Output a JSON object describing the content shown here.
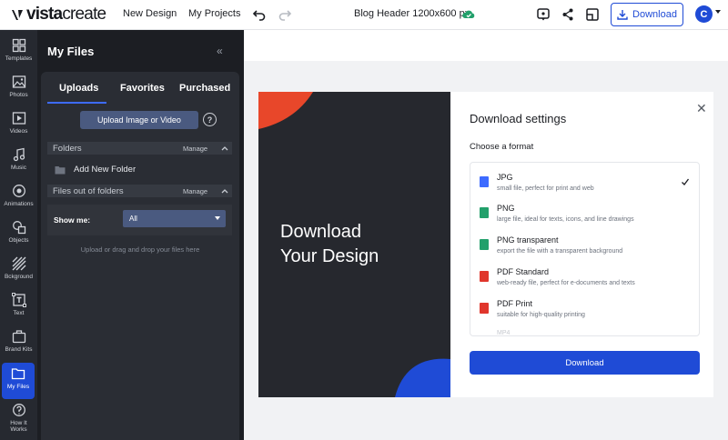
{
  "header": {
    "logo_bold": "vista",
    "logo_light": "create",
    "nav": [
      "New Design",
      "My Projects"
    ],
    "doc_title": "Blog Header 1200x600 px",
    "download_label": "Download",
    "avatar_initial": "C"
  },
  "rail": {
    "items": [
      {
        "label": "Templates",
        "icon": "templates-icon"
      },
      {
        "label": "Photos",
        "icon": "photos-icon"
      },
      {
        "label": "Videos",
        "icon": "videos-icon"
      },
      {
        "label": "Music",
        "icon": "music-icon"
      },
      {
        "label": "Animations",
        "icon": "animations-icon"
      },
      {
        "label": "Objects",
        "icon": "objects-icon"
      },
      {
        "label": "Bckground",
        "icon": "background-icon"
      },
      {
        "label": "Text",
        "icon": "text-icon"
      },
      {
        "label": "Brand Kits",
        "icon": "brand-kits-icon"
      },
      {
        "label": "My Files",
        "icon": "my-files-icon",
        "active": true
      },
      {
        "label": "How It Works",
        "icon": "how-it-works-icon"
      }
    ]
  },
  "files_panel": {
    "title": "My Files",
    "tabs": [
      "Uploads",
      "Favorites",
      "Purchased"
    ],
    "active_tab": "Uploads",
    "upload_button": "Upload Image or Video",
    "help_glyph": "?",
    "folders_section": {
      "label": "Folders",
      "manage": "Manage"
    },
    "add_folder": "Add New Folder",
    "loose_section": {
      "label": "Files out of folders",
      "manage": "Manage"
    },
    "show_me_label": "Show me:",
    "show_me_value": "All",
    "drop_hint": "Upload or drag and drop your files here"
  },
  "design": {
    "line1": "Download",
    "line2": "Your Design",
    "accent_top": "#e8472a",
    "accent_bottom": "#1f4bd6"
  },
  "download_dialog": {
    "title": "Download settings",
    "subtitle": "Choose a format",
    "formats": [
      {
        "name": "JPG",
        "desc": "small file, perfect for print and web",
        "icon_color": "#3d6bff",
        "selected": true
      },
      {
        "name": "PNG",
        "desc": "large file, ideal for texts, icons, and line drawings",
        "icon_color": "#22a06b",
        "selected": false
      },
      {
        "name": "PNG transparent",
        "desc": "export the file with a transparent background",
        "icon_color": "#22a06b",
        "selected": false
      },
      {
        "name": "PDF Standard",
        "desc": "web-ready file, perfect for e-documents and texts",
        "icon_color": "#e0362c",
        "selected": false
      },
      {
        "name": "PDF Print",
        "desc": "suitable for high-quality printing",
        "icon_color": "#e0362c",
        "selected": false
      }
    ],
    "partial_next": "MP4",
    "button": "Download"
  },
  "colors": {
    "brand_blue": "#1f4bd6",
    "panel_dark": "#1c1e23",
    "rail_dark": "#262930"
  }
}
